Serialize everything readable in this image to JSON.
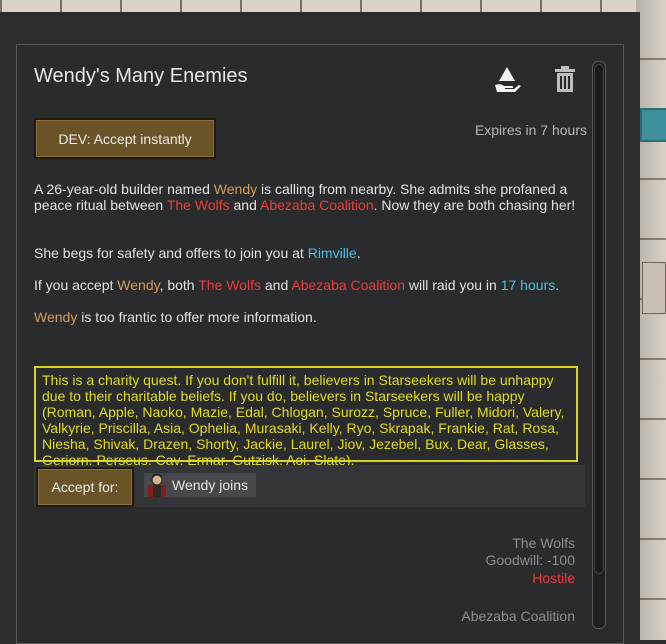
{
  "quest": {
    "title": "Wendy's Many Enemies",
    "dev_button": "DEV: Accept instantly",
    "expires": "Expires in 7 hours",
    "icons": {
      "dismiss": "dismiss-icon",
      "delete": "trash-icon"
    },
    "para1": {
      "t1": "A 26-year-old builder named ",
      "pawn": "Wendy",
      "t2": " is calling from nearby. She admits she profaned a peace ritual between ",
      "f1": "The Wolfs",
      "t3": " and ",
      "f2": "Abezaba Coalition",
      "t4": ". Now they are both chasing her!"
    },
    "para2": {
      "t1": "She begs for safety and offers to join you at ",
      "place": "Rimville",
      "t2": "."
    },
    "para3": {
      "t1": "If you accept ",
      "pawn": "Wendy",
      "t2": ", both ",
      "f1": "The Wolfs",
      "t3": " and ",
      "f2": "Abezaba Coalition",
      "t4": " will raid you in ",
      "time": "17 hours",
      "t5": "."
    },
    "para4": {
      "pawn": "Wendy",
      "t1": " is too frantic to offer more information."
    },
    "charity": "This is a charity quest. If you don't fulfill it, believers in Starseekers will be unhappy due to their charitable beliefs. If you do, believers in Starseekers will be happy (Roman, Apple, Naoko, Mazie, Edal, Chlogan, Surozz, Spruce, Fuller, Midori, Valery, Valkyrie, Priscilla, Asia, Ophelia, Murasaki, Kelly, Ryo, Skrapak, Frankie, Rat, Rosa, Niesha, Shivak, Drazen, Shorty, Jackie, Laurel, Jiov, Jezebel, Bux, Dear, Glasses, Gerjorn, Perseus, Cav, Ermar, Gutzisk, Aoi, Slate).",
    "accept_label": "Accept for:",
    "reward": "Wendy joins",
    "factions": [
      {
        "name": "The Wolfs",
        "goodwill": "Goodwill: -100",
        "status": "Hostile"
      },
      {
        "name": "Abezaba Coalition"
      }
    ]
  },
  "colors": {
    "pawn": "#d89a5e",
    "faction": "#ef3b3b",
    "place": "#4bc1e0",
    "charity": "#dad31e",
    "button": "#6b5328"
  }
}
